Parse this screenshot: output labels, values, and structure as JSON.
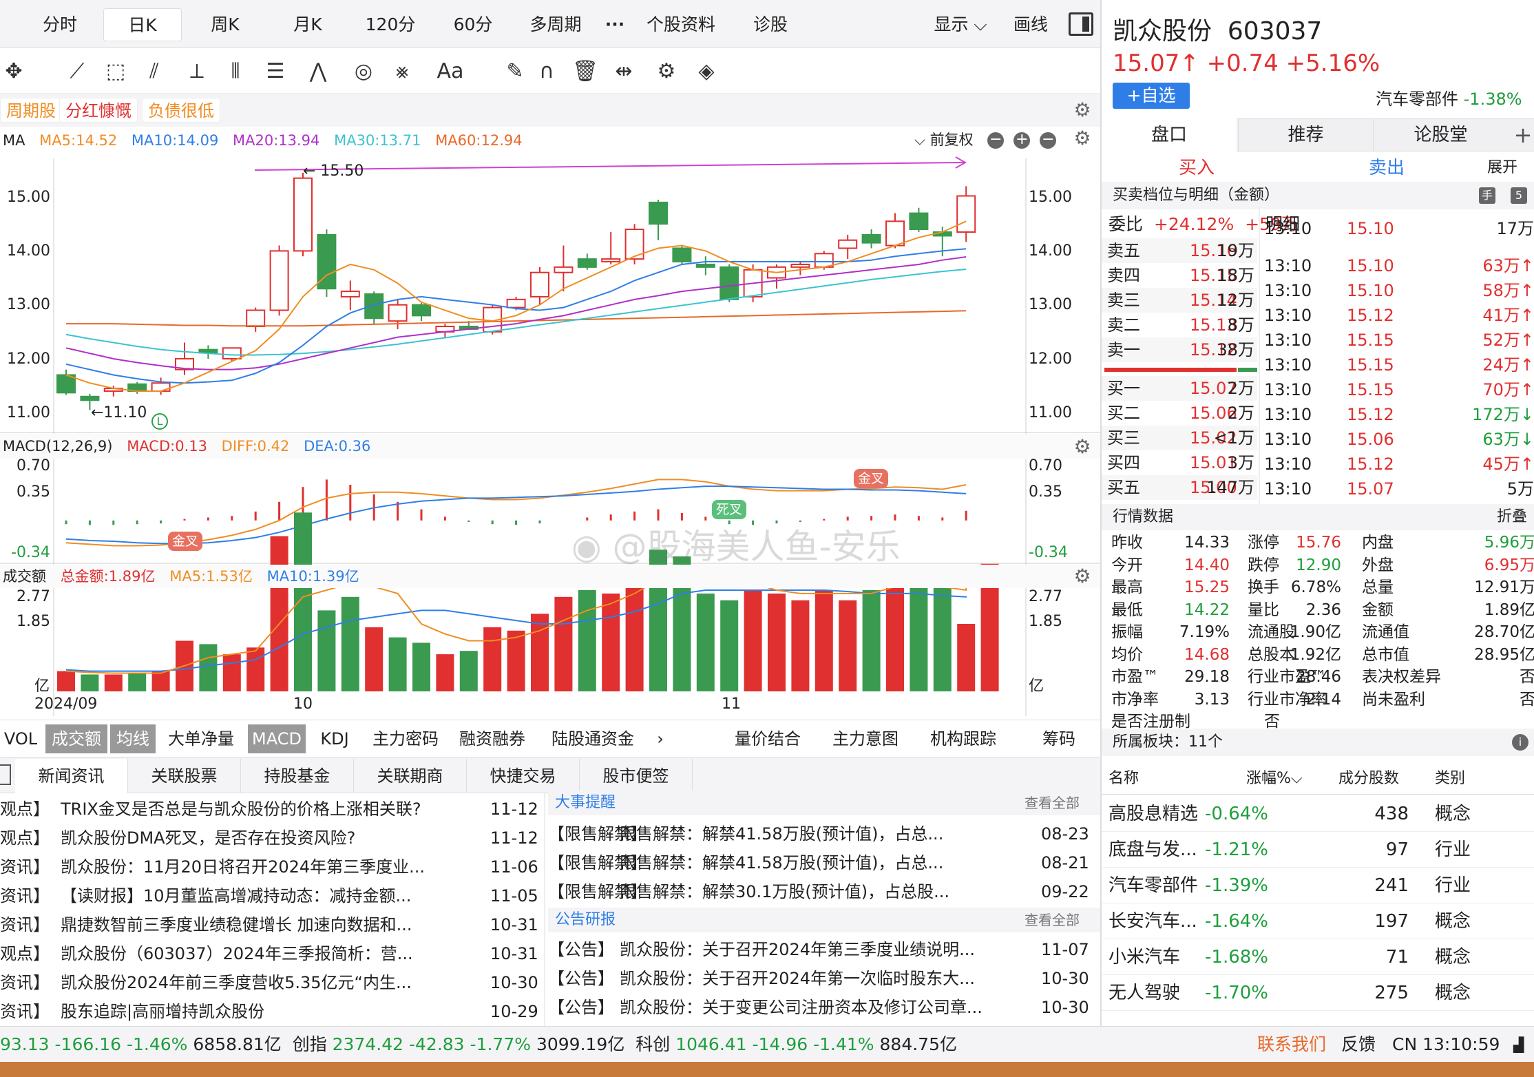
{
  "top_tabs": [
    {
      "label": "分时"
    },
    {
      "label": "日K",
      "active": true
    },
    {
      "label": "周K"
    },
    {
      "label": "月K"
    },
    {
      "label": "120分"
    },
    {
      "label": "60分"
    },
    {
      "label": "多周期"
    },
    {
      "label": "···"
    },
    {
      "label": "个股资料"
    },
    {
      "label": "诊股"
    }
  ],
  "top_right": {
    "display": "显示",
    "draw": "画线"
  },
  "tool_icons": [
    "move-icon",
    "line-icon",
    "rect-icon",
    "fan-icon",
    "channel-icon",
    "grid-lines-icon",
    "text-lines-icon",
    "wave-icon",
    "cycle-icon",
    "fork-icon",
    "text-icon",
    "eraser-icon",
    "magnet-icon",
    "trash-icon",
    "distribute-icon",
    "settings-icon",
    "layers-icon"
  ],
  "tool_glyphs": [
    "✥",
    "⟋",
    "⬚",
    "⫽",
    "⟂",
    "⦀",
    "☰",
    "⋀",
    "◎",
    "⨳",
    "Aa",
    "✎",
    "∩",
    "🗑",
    "⇹",
    "⚙",
    "◈"
  ],
  "tags": [
    "周期股",
    "分红慷慨",
    "负债很低"
  ],
  "ma_legend": {
    "label": "MA",
    "ma5": "MA5:14.52",
    "ma10": "MA10:14.09",
    "ma20": "MA20:13.94",
    "ma30": "MA30:13.71",
    "ma60": "MA60:12.94",
    "adjust": "前复权"
  },
  "kline": {
    "y_ticks": [
      "15.00",
      "14.00",
      "13.00",
      "12.00",
      "11.00"
    ],
    "high_label": "← 15.50",
    "low_label": "←11.10",
    "marker": "L",
    "candles": [
      {
        "o": 11.75,
        "h": 11.85,
        "l": 11.38,
        "c": 11.42
      },
      {
        "o": 11.35,
        "h": 11.4,
        "l": 11.1,
        "c": 11.28
      },
      {
        "o": 11.45,
        "h": 11.55,
        "l": 11.35,
        "c": 11.5
      },
      {
        "o": 11.58,
        "h": 11.62,
        "l": 11.4,
        "c": 11.45
      },
      {
        "o": 11.45,
        "h": 11.7,
        "l": 11.38,
        "c": 11.6
      },
      {
        "o": 11.85,
        "h": 12.35,
        "l": 11.75,
        "c": 12.05
      },
      {
        "o": 12.22,
        "h": 12.3,
        "l": 12.05,
        "c": 12.16
      },
      {
        "o": 12.05,
        "h": 12.25,
        "l": 12.0,
        "c": 12.25
      },
      {
        "o": 12.65,
        "h": 13.0,
        "l": 12.55,
        "c": 12.95
      },
      {
        "o": 12.95,
        "h": 14.15,
        "l": 12.85,
        "c": 14.05
      },
      {
        "o": 14.05,
        "h": 15.5,
        "l": 13.95,
        "c": 15.4
      },
      {
        "o": 14.35,
        "h": 14.45,
        "l": 13.2,
        "c": 13.35
      },
      {
        "o": 13.2,
        "h": 13.5,
        "l": 12.95,
        "c": 13.3
      },
      {
        "o": 13.25,
        "h": 13.3,
        "l": 12.7,
        "c": 12.8
      },
      {
        "o": 12.75,
        "h": 13.15,
        "l": 12.6,
        "c": 13.05
      },
      {
        "o": 13.05,
        "h": 13.1,
        "l": 12.75,
        "c": 12.85
      },
      {
        "o": 12.55,
        "h": 12.7,
        "l": 12.45,
        "c": 12.65
      },
      {
        "o": 12.65,
        "h": 12.75,
        "l": 12.6,
        "c": 12.6
      },
      {
        "o": 12.55,
        "h": 13.05,
        "l": 12.5,
        "c": 13.0
      },
      {
        "o": 13.0,
        "h": 13.2,
        "l": 12.95,
        "c": 13.15
      },
      {
        "o": 13.2,
        "h": 13.75,
        "l": 13.05,
        "c": 13.65
      },
      {
        "o": 13.65,
        "h": 14.15,
        "l": 13.3,
        "c": 13.75
      },
      {
        "o": 13.9,
        "h": 14.0,
        "l": 13.7,
        "c": 13.75
      },
      {
        "o": 13.85,
        "h": 14.4,
        "l": 13.8,
        "c": 13.9
      },
      {
        "o": 13.9,
        "h": 14.55,
        "l": 13.8,
        "c": 14.45
      },
      {
        "o": 14.95,
        "h": 15.0,
        "l": 14.25,
        "c": 14.55
      },
      {
        "o": 14.1,
        "h": 14.15,
        "l": 13.8,
        "c": 13.85
      },
      {
        "o": 13.8,
        "h": 13.95,
        "l": 13.6,
        "c": 13.75
      },
      {
        "o": 13.75,
        "h": 13.8,
        "l": 13.1,
        "c": 13.15
      },
      {
        "o": 13.2,
        "h": 13.8,
        "l": 13.1,
        "c": 13.7
      },
      {
        "o": 13.55,
        "h": 13.8,
        "l": 13.35,
        "c": 13.75
      },
      {
        "o": 13.75,
        "h": 13.85,
        "l": 13.6,
        "c": 13.8
      },
      {
        "o": 13.75,
        "h": 14.05,
        "l": 13.7,
        "c": 14.0
      },
      {
        "o": 14.1,
        "h": 14.35,
        "l": 13.9,
        "c": 14.25
      },
      {
        "o": 14.35,
        "h": 14.45,
        "l": 14.1,
        "c": 14.2
      },
      {
        "o": 14.15,
        "h": 14.75,
        "l": 14.1,
        "c": 14.6
      },
      {
        "o": 14.75,
        "h": 14.85,
        "l": 14.4,
        "c": 14.45
      },
      {
        "o": 14.4,
        "h": 14.5,
        "l": 13.95,
        "c": 14.33
      },
      {
        "o": 14.4,
        "h": 15.25,
        "l": 14.22,
        "c": 15.07
      }
    ],
    "ma5": [
      11.75,
      11.6,
      11.5,
      11.45,
      11.45,
      11.6,
      11.8,
      12.0,
      12.2,
      12.6,
      13.2,
      13.6,
      13.8,
      13.7,
      13.45,
      13.1,
      12.95,
      12.8,
      12.75,
      12.85,
      13.05,
      13.35,
      13.55,
      13.75,
      13.95,
      14.1,
      14.15,
      14.05,
      13.85,
      13.7,
      13.65,
      13.7,
      13.75,
      13.85,
      14.0,
      14.15,
      14.3,
      14.4,
      14.6
    ],
    "ma10": [
      11.95,
      11.85,
      11.75,
      11.68,
      11.62,
      11.6,
      11.62,
      11.65,
      11.78,
      11.98,
      12.3,
      12.65,
      12.9,
      13.05,
      13.15,
      13.2,
      13.15,
      13.1,
      13.05,
      12.98,
      12.95,
      13.0,
      13.15,
      13.3,
      13.5,
      13.65,
      13.8,
      13.85,
      13.85,
      13.85,
      13.85,
      13.85,
      13.85,
      13.85,
      13.88,
      13.95,
      14.0,
      14.05,
      14.09
    ],
    "ma20": [
      12.25,
      12.15,
      12.05,
      11.98,
      11.92,
      11.87,
      11.85,
      11.85,
      11.88,
      11.95,
      12.05,
      12.15,
      12.25,
      12.35,
      12.45,
      12.5,
      12.55,
      12.6,
      12.65,
      12.7,
      12.78,
      12.85,
      12.95,
      13.05,
      13.15,
      13.22,
      13.3,
      13.35,
      13.4,
      13.45,
      13.5,
      13.55,
      13.6,
      13.65,
      13.7,
      13.75,
      13.8,
      13.88,
      13.94
    ],
    "ma30": [
      12.5,
      12.42,
      12.35,
      12.28,
      12.22,
      12.18,
      12.15,
      12.12,
      12.12,
      12.13,
      12.15,
      12.18,
      12.22,
      12.27,
      12.32,
      12.38,
      12.44,
      12.5,
      12.56,
      12.62,
      12.68,
      12.74,
      12.8,
      12.86,
      12.92,
      12.98,
      13.04,
      13.1,
      13.16,
      13.22,
      13.28,
      13.34,
      13.4,
      13.46,
      13.52,
      13.57,
      13.62,
      13.67,
      13.71
    ],
    "ma60": [
      12.7,
      12.7,
      12.7,
      12.69,
      12.68,
      12.67,
      12.67,
      12.66,
      12.66,
      12.66,
      12.66,
      12.67,
      12.68,
      12.69,
      12.7,
      12.71,
      12.72,
      12.73,
      12.74,
      12.75,
      12.76,
      12.77,
      12.78,
      12.79,
      12.8,
      12.81,
      12.82,
      12.83,
      12.84,
      12.85,
      12.86,
      12.87,
      12.88,
      12.89,
      12.9,
      12.91,
      12.92,
      12.93,
      12.94
    ]
  },
  "macd_legend": {
    "label": "MACD(12,26,9)",
    "macd": "MACD:0.13",
    "diff": "DIFF:0.42",
    "dea": "DEA:0.36"
  },
  "macd": {
    "y_ticks": [
      "0.70",
      "0.35",
      "-0.34"
    ],
    "golden_label": "金叉",
    "death_label": "死叉",
    "hist": [
      -0.05,
      -0.06,
      -0.06,
      -0.05,
      -0.04,
      0.02,
      0.04,
      0.06,
      0.12,
      0.25,
      0.45,
      0.55,
      0.48,
      0.35,
      0.25,
      0.15,
      0.05,
      -0.02,
      -0.05,
      -0.06,
      -0.04,
      0.0,
      0.04,
      0.08,
      0.12,
      0.15,
      0.1,
      0.05,
      -0.05,
      -0.06,
      -0.04,
      -0.02,
      0.02,
      0.05,
      0.06,
      0.08,
      0.06,
      0.04,
      0.13
    ],
    "diff": [
      -0.3,
      -0.32,
      -0.34,
      -0.34,
      -0.33,
      -0.3,
      -0.26,
      -0.2,
      -0.12,
      0.0,
      0.18,
      0.3,
      0.36,
      0.38,
      0.38,
      0.36,
      0.33,
      0.3,
      0.28,
      0.28,
      0.3,
      0.34,
      0.38,
      0.43,
      0.49,
      0.55,
      0.55,
      0.52,
      0.46,
      0.42,
      0.4,
      0.4,
      0.4,
      0.42,
      0.43,
      0.45,
      0.44,
      0.42,
      0.48
    ],
    "dea": [
      -0.25,
      -0.27,
      -0.28,
      -0.3,
      -0.31,
      -0.31,
      -0.3,
      -0.27,
      -0.23,
      -0.16,
      -0.07,
      0.02,
      0.1,
      0.17,
      0.22,
      0.26,
      0.28,
      0.3,
      0.3,
      0.31,
      0.32,
      0.33,
      0.35,
      0.37,
      0.39,
      0.42,
      0.44,
      0.46,
      0.46,
      0.45,
      0.44,
      0.43,
      0.42,
      0.42,
      0.41,
      0.41,
      0.4,
      0.38,
      0.36
    ]
  },
  "vol_legend": {
    "label": "成交额",
    "total": "总金额:1.89亿",
    "ma5": "MA5:1.53亿",
    "ma10": "MA10:1.39亿"
  },
  "volume": {
    "y_ticks": [
      "2.77",
      "1.85"
    ],
    "unit": "亿",
    "x_labels": [
      "2024/09",
      "10",
      "11"
    ],
    "bars": [
      0.3,
      0.25,
      0.25,
      0.28,
      0.3,
      0.75,
      0.7,
      0.55,
      0.65,
      2.3,
      2.65,
      1.2,
      1.4,
      0.95,
      0.8,
      0.72,
      0.55,
      0.6,
      0.95,
      0.9,
      1.15,
      1.4,
      1.5,
      1.45,
      1.55,
      2.1,
      2.0,
      1.45,
      1.35,
      1.5,
      1.45,
      1.35,
      1.5,
      1.35,
      1.5,
      1.8,
      1.6,
      1.55,
      1.0,
      1.89
    ],
    "ma5": [
      0.3,
      0.28,
      0.27,
      0.27,
      0.27,
      0.38,
      0.5,
      0.55,
      0.6,
      1.0,
      1.4,
      1.5,
      1.6,
      1.55,
      1.45,
      1.0,
      0.85,
      0.75,
      0.75,
      0.8,
      0.9,
      1.05,
      1.2,
      1.3,
      1.45,
      1.65,
      1.75,
      1.7,
      1.65,
      1.6,
      1.5,
      1.45,
      1.45,
      1.45,
      1.45,
      1.55,
      1.6,
      1.55,
      1.5,
      1.53
    ],
    "ma10": [
      0.32,
      0.3,
      0.3,
      0.3,
      0.3,
      0.33,
      0.38,
      0.42,
      0.47,
      0.65,
      0.85,
      0.95,
      1.05,
      1.1,
      1.15,
      1.2,
      1.2,
      1.15,
      1.1,
      1.05,
      1.0,
      1.0,
      1.05,
      1.1,
      1.18,
      1.3,
      1.45,
      1.5,
      1.5,
      1.5,
      1.5,
      1.5,
      1.5,
      1.48,
      1.45,
      1.45,
      1.45,
      1.42,
      1.4,
      1.39
    ],
    "up": [
      1,
      0,
      1,
      0,
      1,
      1,
      0,
      1,
      1,
      1,
      0,
      0,
      0,
      1,
      0,
      0,
      1,
      0,
      1,
      1,
      1,
      1,
      0,
      1,
      1,
      0,
      0,
      0,
      0,
      1,
      1,
      1,
      1,
      1,
      0,
      1,
      0,
      0,
      1,
      1
    ]
  },
  "bottom_tabs": [
    "VOL",
    "成交额",
    "均线",
    "大单净量",
    "MACD",
    "KDJ",
    "主力密码",
    "融资融券",
    "陆股通资金",
    "量价结合",
    "主力意图",
    "机构跟踪",
    "筹码"
  ],
  "l2_badge": "L2",
  "news_tabs": [
    "新闻资讯",
    "关联股票",
    "持股基金",
    "关联期商",
    "快捷交易",
    "股市便签"
  ],
  "news": [
    {
      "tag": "观点】",
      "title": "TRIX金叉是否总是与凯众股份的价格上涨相关联?",
      "date": "11-12"
    },
    {
      "tag": "观点】",
      "title": "凯众股份DMA死叉，是否存在投资风险?",
      "date": "11-12"
    },
    {
      "tag": "资讯】",
      "title": "凯众股份：11月20日将召开2024年第三季度业...",
      "date": "11-06"
    },
    {
      "tag": "资讯】",
      "title": "【读财报】10月董监高增减持动态：减持金额...",
      "date": "11-05"
    },
    {
      "tag": "资讯】",
      "title": "鼎捷数智前三季度业绩稳健增长 加速向数据和...",
      "date": "10-31"
    },
    {
      "tag": "观点】",
      "title": "凯众股份（603037）2024年三季报简析：营...",
      "date": "10-31"
    },
    {
      "tag": "资讯】",
      "title": "凯众股份2024年前三季度营收5.35亿元“内生...",
      "date": "10-30"
    },
    {
      "tag": "资讯】",
      "title": "股东追踪|高丽增持凯众股份",
      "date": "10-29"
    }
  ],
  "events": {
    "header": "大事提醒",
    "view_all": "查看全部",
    "items": [
      {
        "tag": "【限售解禁】",
        "title": "限售解禁：解禁41.58万股(预计值)，占总...",
        "date": "08-23"
      },
      {
        "tag": "【限售解禁】",
        "title": "限售解禁：解禁41.58万股(预计值)，占总...",
        "date": "08-21"
      },
      {
        "tag": "【限售解禁】",
        "title": "限售解禁：解禁30.1万股(预计值)，占总股...",
        "date": "09-22"
      }
    ]
  },
  "reports": {
    "header": "公告研报",
    "view_all": "查看全部",
    "items": [
      {
        "tag": "【公告】",
        "title": "凯众股份：关于召开2024年第三季度业绩说明...",
        "date": "11-07"
      },
      {
        "tag": "【公告】",
        "title": "凯众股份：关于召开2024年第一次临时股东大...",
        "date": "10-30"
      },
      {
        "tag": "【公告】",
        "title": "凯众股份：关于变更公司注册资本及修订公司章...",
        "date": "10-30"
      }
    ]
  },
  "status": {
    "sh": "93.13",
    "sh_chg": "-166.16",
    "sh_pct": "-1.46%",
    "sh_amt": "6858.81亿",
    "cy_label": "创指",
    "cy": "2374.42",
    "cy_chg": "-42.83",
    "cy_pct": "-1.77%",
    "cy_amt": "3099.19亿",
    "kc_label": "科创",
    "kc": "1046.41",
    "kc_chg": "-14.96",
    "kc_pct": "-1.41%",
    "kc_amt": "884.75亿",
    "contact": "联系我们",
    "feedback": "反馈",
    "clock": "CN 13:10:59"
  },
  "watermark": "@股海美人鱼-安乐",
  "stock": {
    "name": "凯众股份",
    "code": "603037",
    "price": "15.07↑",
    "chg": "+0.74",
    "pct": "+5.16%",
    "add_btn": "+自选",
    "sector": "汽车零部件",
    "sector_pct": "-1.38%"
  },
  "right_tabs": [
    "盘口",
    "推荐",
    "论股堂"
  ],
  "buy_label": "买入",
  "sell_label": "卖出",
  "expand": "展开",
  "ob_header": "买卖档位与明细（金额）",
  "weibi": {
    "label": "委比",
    "pct": "+24.12%",
    "val": "+59万"
  },
  "detail_label": "明细",
  "sells": [
    {
      "l": "卖五",
      "p": "15.16",
      "v": "19万"
    },
    {
      "l": "卖四",
      "p": "15.15",
      "v": "18万"
    },
    {
      "l": "卖三",
      "p": "15.14",
      "v": "12万"
    },
    {
      "l": "卖二",
      "p": "15.13",
      "v": "8万"
    },
    {
      "l": "卖一",
      "p": "15.12",
      "v": "38万"
    }
  ],
  "buys": [
    {
      "l": "买一",
      "p": "15.07",
      "v": "2万"
    },
    {
      "l": "买二",
      "p": "15.06",
      "v": "2万"
    },
    {
      "l": "买三",
      "p": "15.02",
      "v": "<1万"
    },
    {
      "l": "买四",
      "p": "15.01",
      "v": "3万"
    },
    {
      "l": "买五",
      "p": "15.00",
      "v": "147万"
    }
  ],
  "ticks": [
    {
      "t": "13:10",
      "p": "15.10",
      "v": "17万"
    },
    {
      "t": "13:10",
      "p": "15.10",
      "v": "63万↑"
    },
    {
      "t": "13:10",
      "p": "15.10",
      "v": "58万↑"
    },
    {
      "t": "13:10",
      "p": "15.12",
      "v": "41万↑"
    },
    {
      "t": "13:10",
      "p": "15.15",
      "v": "52万↑"
    },
    {
      "t": "13:10",
      "p": "15.15",
      "v": "24万↑"
    },
    {
      "t": "13:10",
      "p": "15.15",
      "v": "70万↑"
    },
    {
      "t": "13:10",
      "p": "15.12",
      "v": "172万↓"
    },
    {
      "t": "13:10",
      "p": "15.06",
      "v": "63万↓"
    },
    {
      "t": "13:10",
      "p": "15.12",
      "v": "45万↑"
    },
    {
      "t": "13:10",
      "p": "15.07",
      "v": "5万"
    }
  ],
  "market_header": "行情数据",
  "fold": "折叠",
  "market": [
    [
      "昨收",
      "14.33",
      "涨停",
      "15.76",
      "内盘",
      "5.96万"
    ],
    [
      "今开",
      "14.40",
      "跌停",
      "12.90",
      "外盘",
      "6.95万"
    ],
    [
      "最高",
      "15.25",
      "换手",
      "6.78%",
      "总量",
      "12.91万"
    ],
    [
      "最低",
      "14.22",
      "量比",
      "2.36",
      "金额",
      "1.89亿"
    ],
    [
      "振幅",
      "7.19%",
      "流通股",
      "1.90亿",
      "流通值",
      "28.70亿"
    ],
    [
      "均价",
      "14.68",
      "总股本",
      "1.92亿",
      "总市值",
      "28.95亿"
    ],
    [
      "市盈™",
      "29.18",
      "行业市盈™",
      "28.46",
      "表决权差异",
      "否"
    ],
    [
      "市净率",
      "3.13",
      "行业市净率",
      "2.14",
      "尚未盈利",
      "否"
    ],
    [
      "是否注册制",
      "否",
      "",
      "",
      "",
      ""
    ]
  ],
  "sectors_header": "所属板块：11个",
  "sector_cols": [
    "名称",
    "涨幅%",
    "成分股数",
    "类别"
  ],
  "sector_rows": [
    {
      "n": "高股息精选",
      "p": "-0.64%",
      "c": "438",
      "t": "概念"
    },
    {
      "n": "底盘与发...",
      "p": "-1.21%",
      "c": "97",
      "t": "行业"
    },
    {
      "n": "汽车零部件",
      "p": "-1.39%",
      "c": "241",
      "t": "行业"
    },
    {
      "n": "长安汽车...",
      "p": "-1.64%",
      "c": "197",
      "t": "概念"
    },
    {
      "n": "小米汽车",
      "p": "-1.68%",
      "c": "71",
      "t": "概念"
    },
    {
      "n": "无人驾驶",
      "p": "-1.70%",
      "c": "275",
      "t": "概念"
    }
  ]
}
